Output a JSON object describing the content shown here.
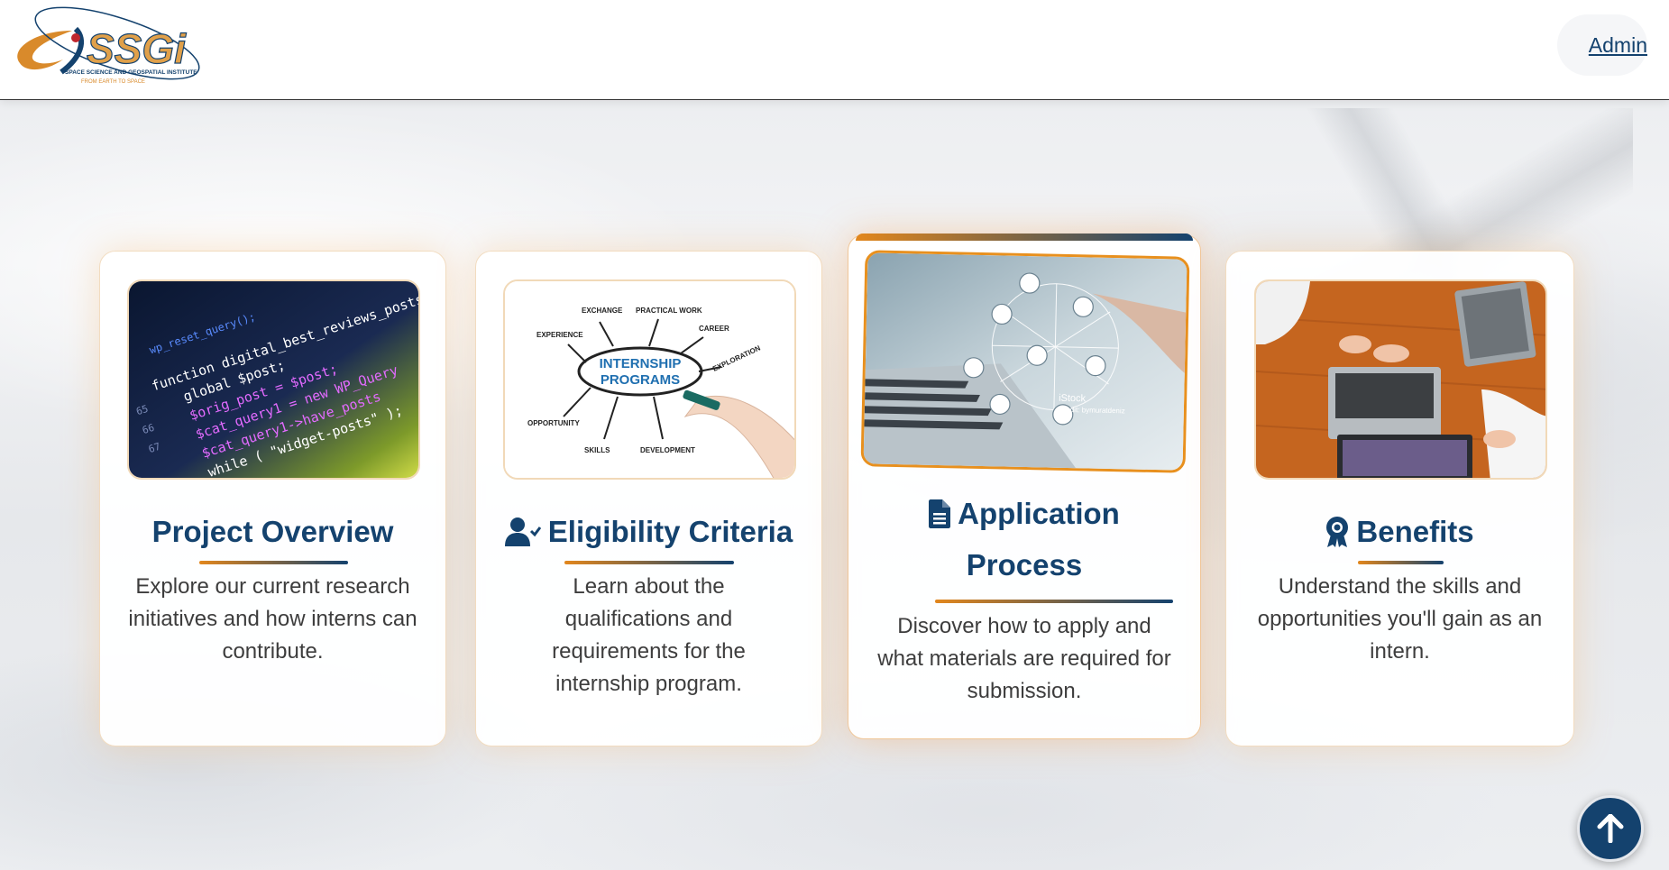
{
  "header": {
    "logo_text": "SSGi",
    "logo_subtitle": "SPACE SCIENCE AND GEOSPATIAL INSTITUTE",
    "logo_tagline": "FROM EARTH TO SPACE",
    "admin_label": "Admin"
  },
  "cards": [
    {
      "title": "Project Overview",
      "icon": "none",
      "description": "Explore our current research initiatives and how interns can contribute.",
      "image_text": [
        "function digital_best_reviews_posts",
        "global $post;",
        "$orig_post = $post;",
        "$cat_query1 = new WP_Query",
        "$cat_query1->have_posts"
      ]
    },
    {
      "title": "Eligibility Criteria",
      "icon": "user-check-icon",
      "description": "Learn about the qualifications and requirements for the internship program.",
      "image_text": [
        "INTERNSHIP",
        "PROGRAMS",
        "EXCHANGE",
        "PRACTICAL WORK",
        "CAREER",
        "EXPLORATION",
        "EXPERIENCE",
        "OPPORTUNITY",
        "SKILLS",
        "DEVELOPMENT"
      ]
    },
    {
      "title_line1": "Application",
      "title_line2": "Process",
      "icon": "file-icon",
      "description": "Discover how to apply and what materials are required for submission.",
      "image_text": [
        "iStock",
        "Credit: bymuratdeniz"
      ]
    },
    {
      "title": "Benefits",
      "icon": "award-icon",
      "description": "Understand the skills and opportunities you'll gain as an intern."
    }
  ],
  "colors": {
    "primary": "#14426e",
    "accent": "#e2871d",
    "text": "#3d3d3d"
  },
  "scroll_top_icon": "arrow-up-icon"
}
